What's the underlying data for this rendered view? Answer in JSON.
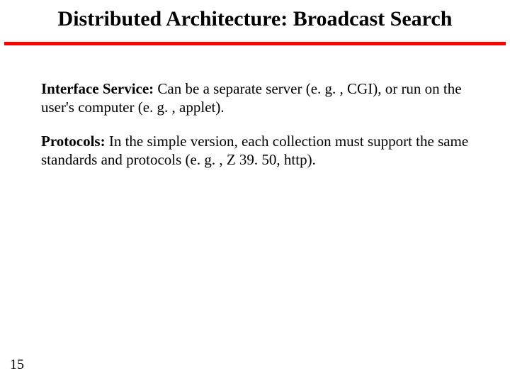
{
  "title": "Distributed Architecture: Broadcast Search",
  "para1": {
    "label": "Interface Service:",
    "text": "  Can be a separate server (e. g. , CGI), or run on the user's computer (e. g. , applet)."
  },
  "para2": {
    "label": "Protocols:",
    "text": "  In the simple version, each collection must support the same standards and protocols (e. g. , Z 39. 50, http)."
  },
  "page_number": "15"
}
